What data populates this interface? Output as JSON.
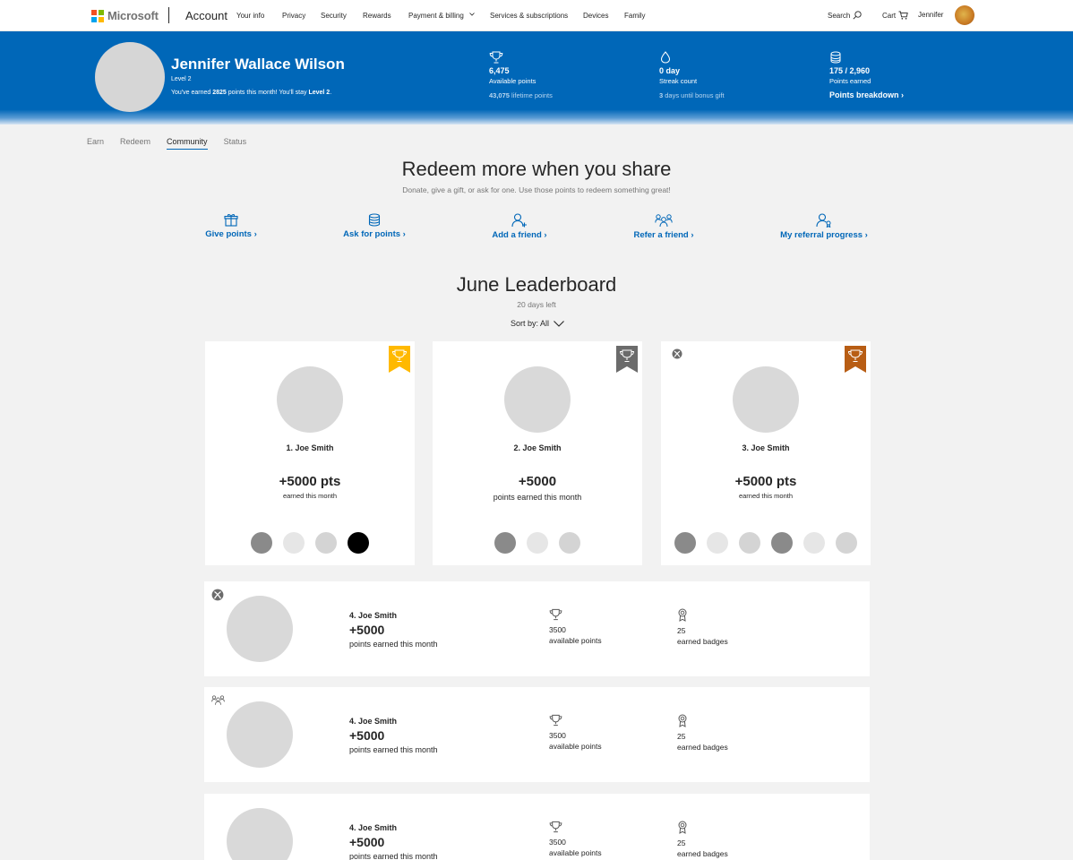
{
  "nav": {
    "brand": "Microsoft",
    "account": "Account",
    "links": [
      "Your info",
      "Privacy",
      "Security",
      "Rewards",
      "Payment & billing",
      "Services & subscriptions",
      "Devices",
      "Family"
    ],
    "search": "Search",
    "cart": "Cart",
    "user": "Jennifer"
  },
  "profile": {
    "name": "Jennifer Wallace Wilson",
    "level": "Level 2",
    "earned_pre": "You've earned ",
    "earned_points": "2825",
    "earned_mid": " points this month! You'll stay ",
    "earned_level": "Level 2",
    "earned_post": "."
  },
  "stats": {
    "available": {
      "value": "6,475",
      "label": "Available points",
      "lifetime_value": "43,075",
      "lifetime_label": " lifetime points"
    },
    "streak": {
      "value": "0 day",
      "label": "Streak count",
      "bonus_value": "3",
      "bonus_label": " days until bonus gift"
    },
    "earned": {
      "value": "175 / 2,960",
      "label": "Points earned",
      "link": "Points breakdown ›"
    }
  },
  "tabs": [
    "Earn",
    "Redeem",
    "Community",
    "Status"
  ],
  "share": {
    "title": "Redeem more when you share",
    "subtitle": "Donate, give a gift, or ask for one. Use those points to redeem something great!",
    "actions": [
      "Give points ›",
      "Ask for points ›",
      "Add a friend ›",
      "Refer a friend ›",
      "My referral progress ›"
    ]
  },
  "leaderboard": {
    "title": "June Leaderboard",
    "days_left": "20 days left",
    "sort_label": "Sort by: All",
    "top": [
      {
        "name": "1. Joe Smith",
        "points": "+5000 pts",
        "caption": "earned this month",
        "badge_color": "#ffb900"
      },
      {
        "name": "2. Joe Smith",
        "points": "+5000",
        "caption": "points earned this month",
        "badge_color": "#6b6b6b"
      },
      {
        "name": "3. Joe Smith",
        "points": "+5000 pts",
        "caption": "earned this month",
        "badge_color": "#b85d14"
      }
    ],
    "rows": [
      {
        "name": "4.  Joe Smith",
        "points": "+5000",
        "caption": "points earned this month",
        "available_value": "3500",
        "available_label": "available points",
        "badges_value": "25",
        "badges_label": "earned badges"
      },
      {
        "name": "4.  Joe Smith",
        "points": "+5000",
        "caption": "points earned this month",
        "available_value": "3500",
        "available_label": "available points",
        "badges_value": "25",
        "badges_label": "earned badges"
      },
      {
        "name": "4.  Joe Smith",
        "points": "+5000",
        "caption": "points earned this month",
        "available_value": "3500",
        "available_label": "available points",
        "badges_value": "25",
        "badges_label": "earned badges"
      }
    ]
  },
  "colors": {
    "brand_blue": "#0067b8",
    "logo": [
      "#f25022",
      "#7fba00",
      "#00a4ef",
      "#ffb900"
    ],
    "dot_dark": "#8a8a8a",
    "dot_light": "#e6e6e6",
    "dot_mid": "#d4d4d4",
    "dot_black": "#000000"
  }
}
